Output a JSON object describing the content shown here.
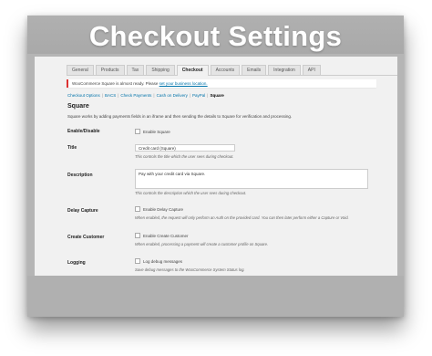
{
  "banner": {
    "title": "Checkout Settings"
  },
  "tabs": [
    {
      "label": "General"
    },
    {
      "label": "Products"
    },
    {
      "label": "Tax"
    },
    {
      "label": "Shipping"
    },
    {
      "label": "Checkout",
      "active": true
    },
    {
      "label": "Accounts"
    },
    {
      "label": "Emails"
    },
    {
      "label": "Integration"
    },
    {
      "label": "API"
    }
  ],
  "notice": {
    "text": "WooCommerce Square is almost ready. Please",
    "link": "set your business location."
  },
  "subnav": {
    "items": [
      "Checkout Options",
      "BACS",
      "Check Payments",
      "Cash on Delivery",
      "PayPal"
    ],
    "current": "Square"
  },
  "section": {
    "title": "Square",
    "description": "Square works by adding payments fields in an iframe and then sending the details to Square for verification and processing."
  },
  "rows": {
    "enable": {
      "label": "Enable/Disable",
      "checkbox": "Enable Square"
    },
    "title": {
      "label": "Title",
      "value": "Credit card (Square)",
      "hint": "This controls the title which the user sees during checkout."
    },
    "description": {
      "label": "Description",
      "value": "Pay with your credit card via Square.",
      "hint": "This controls the description which the user sees during checkout."
    },
    "delay": {
      "label": "Delay Capture",
      "checkbox": "Enable Delay Capture",
      "hint": "When enabled, the request will only perform an Auth on the provided card. You can then later perform either a Capture or Void."
    },
    "customer": {
      "label": "Create Customer",
      "checkbox": "Enable Create Customer",
      "hint": "When enabled, processing a payment will create a customer profile on Square."
    },
    "logging": {
      "label": "Logging",
      "checkbox": "Log debug messages",
      "hint": "Save debug messages to the WooCommerce System Status log."
    }
  }
}
